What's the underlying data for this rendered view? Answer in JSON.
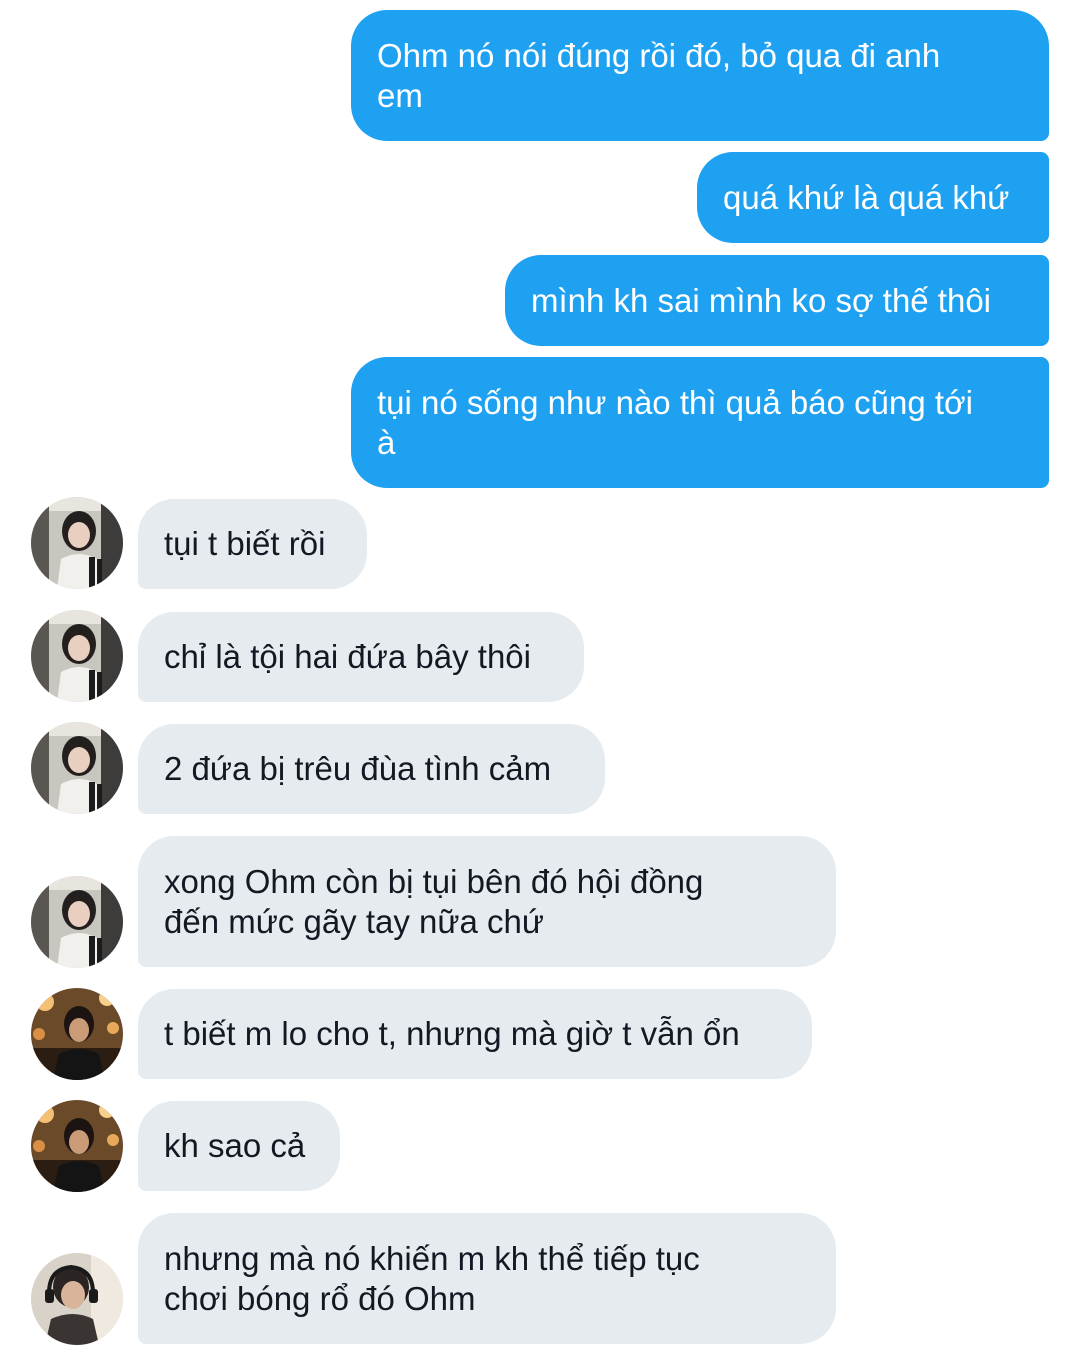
{
  "colors": {
    "sent_bubble": "#1fa1f2",
    "received_bubble": "#e6ebef",
    "sent_text": "#ffffff",
    "received_text": "#141823"
  },
  "messages": [
    {
      "direction": "sent",
      "text": "Ohm nó nói đúng rồi đó, bỏ qua đi anh\nem"
    },
    {
      "direction": "sent",
      "text": "quá khứ là quá khứ"
    },
    {
      "direction": "sent",
      "text": "mình kh sai mình ko sợ thế thôi"
    },
    {
      "direction": "sent",
      "text": "tụi nó sống như nào thì quả báo cũng tới\nà"
    },
    {
      "direction": "received",
      "avatar": "avatar-girl-icon",
      "text": "tụi t biết rồi"
    },
    {
      "direction": "received",
      "avatar": "avatar-girl-icon",
      "text": "chỉ là tội hai đứa bây thôi"
    },
    {
      "direction": "received",
      "avatar": "avatar-girl-icon",
      "text": "2 đứa bị trêu đùa tình cảm"
    },
    {
      "direction": "received",
      "avatar": "avatar-girl-icon",
      "text": "xong Ohm còn bị tụi bên đó hội đồng\nđến mức gãy tay nữa chứ"
    },
    {
      "direction": "received",
      "avatar": "avatar-boy-lights-icon",
      "text": "t biết m lo cho t, nhưng mà giờ t vẫn ổn"
    },
    {
      "direction": "received",
      "avatar": "avatar-boy-lights-icon",
      "text": "kh sao cả"
    },
    {
      "direction": "received",
      "avatar": "avatar-boy-headphones-icon",
      "text": "nhưng mà nó khiến m kh thể tiếp tục\nchơi bóng rổ đó Ohm"
    }
  ]
}
